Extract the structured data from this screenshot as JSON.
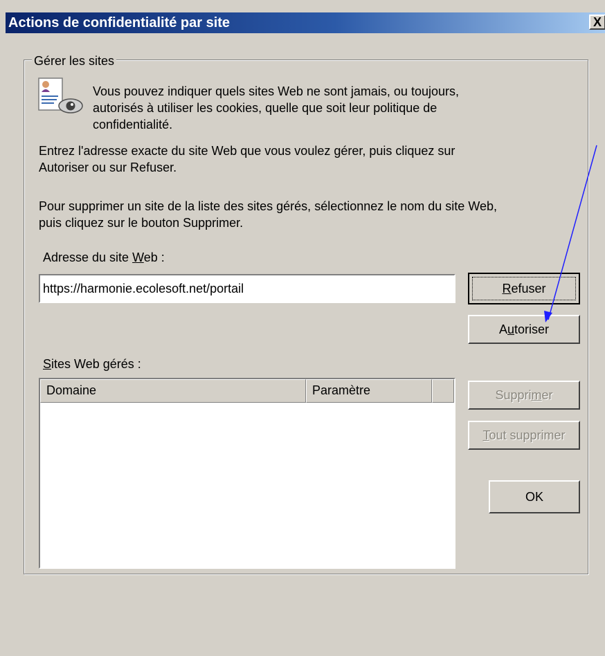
{
  "window": {
    "title": "Actions de confidentialité par site",
    "close_label": "X"
  },
  "group": {
    "legend": "Gérer les sites",
    "intro_line1": "Vous pouvez indiquer quels sites Web ne sont jamais, ou toujours,",
    "intro_line2": "autorisés à utiliser les cookies, quelle que soit leur politique de",
    "intro_line3": "confidentialité.",
    "instr1_line1": "Entrez l'adresse exacte du site Web que vous voulez gérer, puis cliquez sur",
    "instr1_line2": "Autoriser ou sur Refuser.",
    "instr2_line1": "Pour supprimer un site de la liste des sites gérés, sélectionnez le nom du site Web,",
    "instr2_line2": "puis cliquez sur le bouton Supprimer."
  },
  "address": {
    "label_before": "Adresse du site ",
    "label_underlined": "W",
    "label_after": "eb :",
    "value": "https://harmonie.ecolesoft.net/portail"
  },
  "buttons": {
    "refuse": {
      "pre": "",
      "u": "R",
      "post": "efuser"
    },
    "allow": {
      "pre": "A",
      "u": "u",
      "post": "toriser"
    },
    "delete": {
      "pre": "Suppri",
      "u": "m",
      "post": "er"
    },
    "delete_all": {
      "pre": "",
      "u": "T",
      "post": "out supprimer"
    },
    "ok": "OK"
  },
  "managed": {
    "label_underlined": "S",
    "label_after": "ites Web gérés :",
    "columns": [
      "Domaine",
      "Paramètre"
    ],
    "rows": []
  },
  "colors": {
    "title_gradient_start": "#0a246a",
    "title_gradient_end": "#a6caf0",
    "dialog_bg": "#d4d0c8",
    "annotation_arrow": "#1f1fff"
  },
  "icons": {
    "privacy": "privacy-document-eye-icon",
    "annotation": "blue-arrow"
  }
}
